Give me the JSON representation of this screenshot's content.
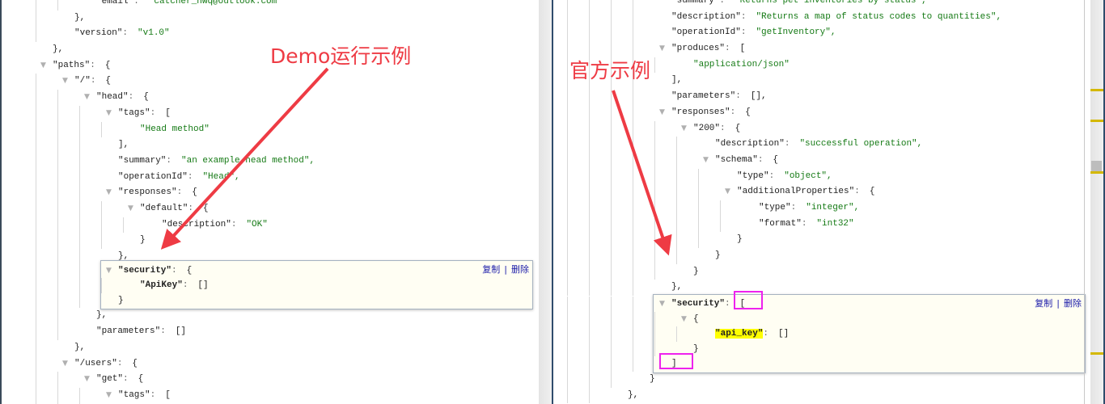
{
  "left": {
    "lines": [
      {
        "d": 2,
        "k": "\"email\"",
        "v": "\"catcher_hwq@outlook.com\""
      },
      {
        "d": 1,
        "raw": "},"
      },
      {
        "d": 1,
        "k": "\"version\"",
        "v": "\"v1.0\""
      },
      {
        "d": 0,
        "raw": "},"
      },
      {
        "d": 0,
        "t": true,
        "k": "\"paths\"",
        "raw": "{"
      },
      {
        "d": 1,
        "t": true,
        "k": "\"/\"",
        "raw": "{"
      },
      {
        "d": 2,
        "t": true,
        "k": "\"head\"",
        "raw": "{"
      },
      {
        "d": 3,
        "t": true,
        "k": "\"tags\"",
        "raw": "["
      },
      {
        "d": 4,
        "v": "\"Head method\""
      },
      {
        "d": 3,
        "raw": "],"
      },
      {
        "d": 3,
        "k": "\"summary\"",
        "v": "\"an example head method\","
      },
      {
        "d": 3,
        "k": "\"operationId\"",
        "v": "\"Head\","
      },
      {
        "d": 3,
        "t": true,
        "k": "\"responses\"",
        "raw": "{"
      },
      {
        "d": 4,
        "t": true,
        "k": "\"default\"",
        "raw": "{"
      },
      {
        "d": 5,
        "k": "\"description\"",
        "v": "\"OK\""
      },
      {
        "d": 4,
        "raw": "}"
      },
      {
        "d": 3,
        "raw": "},"
      }
    ],
    "box": {
      "lines": [
        {
          "d": 3,
          "t": true,
          "k": "\"security\"",
          "bold": true,
          "raw": "{"
        },
        {
          "d": 4,
          "k": "\"ApiKey\"",
          "bold": true,
          "raw": "[]"
        },
        {
          "d": 3,
          "raw": "}"
        }
      ]
    },
    "after": [
      {
        "d": 2,
        "raw": "},"
      },
      {
        "d": 2,
        "k": "\"parameters\"",
        "raw": "[]"
      },
      {
        "d": 1,
        "raw": "},"
      },
      {
        "d": 1,
        "t": true,
        "k": "\"/users\"",
        "raw": "{"
      },
      {
        "d": 2,
        "t": true,
        "k": "\"get\"",
        "raw": "{"
      },
      {
        "d": 3,
        "t": true,
        "k": "\"tags\"",
        "raw": "["
      }
    ]
  },
  "right": {
    "lines": [
      {
        "d": 5,
        "k": "\"summary\"",
        "v": "\"Returns pet inventories by status\","
      },
      {
        "d": 5,
        "k": "\"description\"",
        "v": "\"Returns a map of status codes to quantities\","
      },
      {
        "d": 5,
        "k": "\"operationId\"",
        "v": "\"getInventory\","
      },
      {
        "d": 5,
        "t": true,
        "k": "\"produces\"",
        "raw": "["
      },
      {
        "d": 6,
        "v": "\"application/json\""
      },
      {
        "d": 5,
        "raw": "],"
      },
      {
        "d": 5,
        "k": "\"parameters\"",
        "raw": "[],"
      },
      {
        "d": 5,
        "t": true,
        "k": "\"responses\"",
        "raw": "{"
      },
      {
        "d": 6,
        "t": true,
        "k": "\"200\"",
        "raw": "{"
      },
      {
        "d": 7,
        "k": "\"description\"",
        "v": "\"successful operation\","
      },
      {
        "d": 7,
        "t": true,
        "k": "\"schema\"",
        "raw": "{"
      },
      {
        "d": 8,
        "k": "\"type\"",
        "v": "\"object\","
      },
      {
        "d": 8,
        "t": true,
        "k": "\"additionalProperties\"",
        "raw": "{"
      },
      {
        "d": 9,
        "k": "\"type\"",
        "v": "\"integer\","
      },
      {
        "d": 9,
        "k": "\"format\"",
        "v": "\"int32\""
      },
      {
        "d": 8,
        "raw": "}"
      },
      {
        "d": 7,
        "raw": "}"
      },
      {
        "d": 6,
        "raw": "}"
      },
      {
        "d": 5,
        "raw": "},"
      }
    ],
    "box": {
      "lines": [
        {
          "d": 5,
          "t": true,
          "k": "\"security\"",
          "bold": true,
          "raw": "["
        },
        {
          "d": 6,
          "t": true,
          "raw": "{"
        },
        {
          "d": 7,
          "k": "\"api_key\"",
          "bold": true,
          "hl": true,
          "raw": "[]"
        },
        {
          "d": 6,
          "raw": "}"
        },
        {
          "d": 5,
          "raw": "]"
        }
      ]
    },
    "after": [
      {
        "d": 4,
        "raw": "}"
      },
      {
        "d": 3,
        "raw": "},"
      }
    ]
  },
  "box_actions": {
    "copy": "复制",
    "separator": "|",
    "delete": "删除"
  },
  "annotations": {
    "demo_label": "Demo运行示例",
    "official_label": "官方示例",
    "arrow_color": "#ee3b44",
    "highlight_color": "#ee22ee"
  },
  "colors": {
    "string": "#157a15",
    "key_highlight": "#ffff00",
    "action_link": "#1a1aa8",
    "scroll_marker": "#d4b800"
  }
}
